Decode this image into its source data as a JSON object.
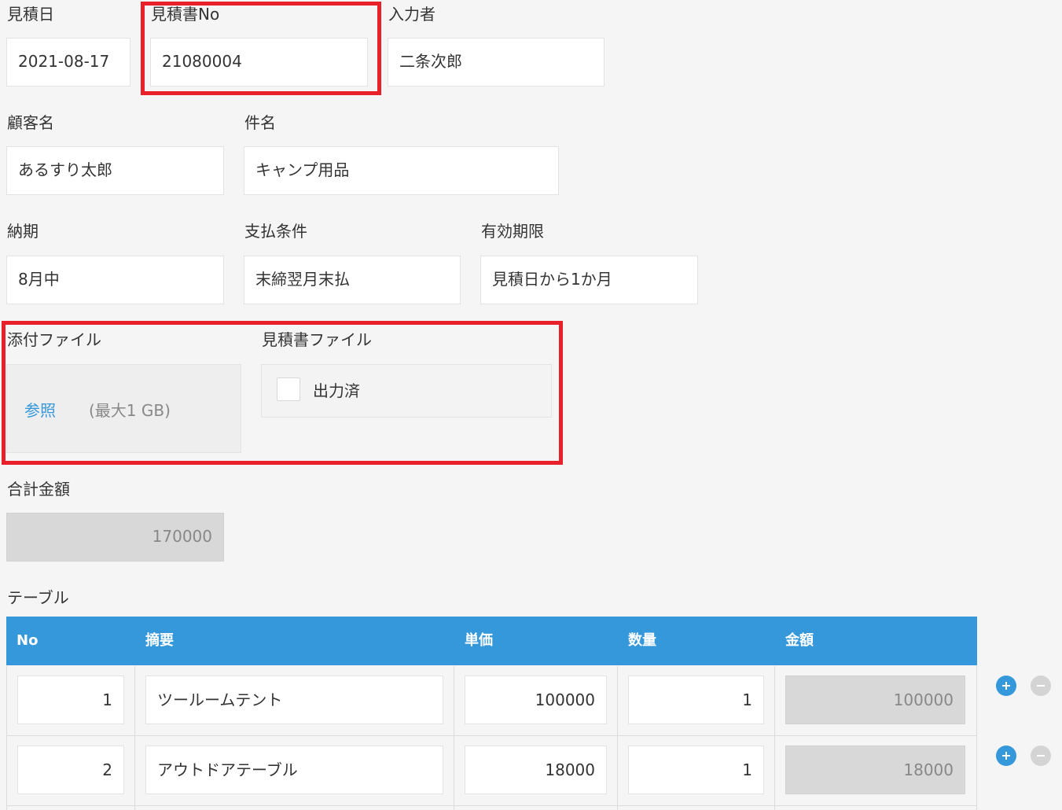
{
  "fields": {
    "estimate_date": {
      "label": "見積日",
      "value": "2021-08-17"
    },
    "estimate_no": {
      "label": "見積書No",
      "value": "21080004"
    },
    "entered_by": {
      "label": "入力者",
      "value": "二条次郎"
    },
    "customer_name": {
      "label": "顧客名",
      "value": "あるすり太郎"
    },
    "subject": {
      "label": "件名",
      "value": "キャンプ用品"
    },
    "delivery": {
      "label": "納期",
      "value": "8月中"
    },
    "payment_terms": {
      "label": "支払条件",
      "value": "末締翌月末払"
    },
    "validity": {
      "label": "有効期限",
      "value": "見積日から1か月"
    },
    "attachment": {
      "label": "添付ファイル",
      "browse": "参照",
      "max_size": "(最大1 GB)"
    },
    "estimate_file": {
      "label": "見積書ファイル",
      "option": "出力済",
      "checked": false
    },
    "total": {
      "label": "合計金額",
      "value": "170000"
    }
  },
  "table": {
    "label": "テーブル",
    "columns": [
      "No",
      "摘要",
      "単価",
      "数量",
      "金額"
    ],
    "rows": [
      {
        "no": "1",
        "desc": "ツールームテント",
        "price": "100000",
        "qty": "1",
        "amount": "100000"
      },
      {
        "no": "2",
        "desc": "アウトドアテーブル",
        "price": "18000",
        "qty": "1",
        "amount": "18000"
      }
    ]
  },
  "colors": {
    "accent": "#3498db",
    "highlight": "#e8202a",
    "readonly_bg": "#d8d8d8"
  }
}
